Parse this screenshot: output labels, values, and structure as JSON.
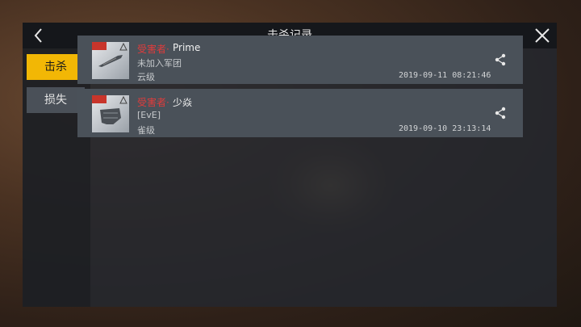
{
  "header": {
    "title": "击杀记录",
    "back_icon": "chevron-left-icon",
    "close_icon": "close-icon"
  },
  "tabs": [
    {
      "label": "击杀",
      "active": true
    },
    {
      "label": "损失",
      "active": false
    }
  ],
  "records": [
    {
      "victim_label": "受害者·",
      "victim_name": "Prime",
      "corporation": "未加入军团",
      "ship_class": "云级",
      "timestamp": "2019-09-11 08:21:46",
      "share_icon": "share-icon"
    },
    {
      "victim_label": "受害者·",
      "victim_name": "少焱",
      "corporation": "[EvE]",
      "ship_class": "雀级",
      "timestamp": "2019-09-10 23:13:14",
      "share_icon": "share-icon"
    }
  ],
  "colors": {
    "accent": "#f2b705",
    "victim_label": "#e03c3c",
    "panel": "#24282e",
    "row": "#4a5159"
  }
}
